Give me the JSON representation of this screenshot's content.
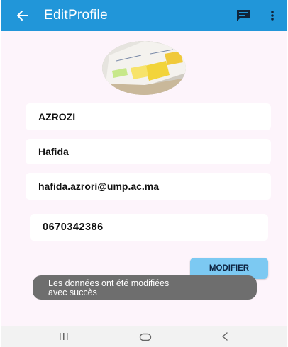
{
  "appbar": {
    "title": "EditProfile",
    "back_icon": "arrow-left-icon",
    "message_icon": "message-icon",
    "more_icon": "more-vertical-icon",
    "color": "#2196d9"
  },
  "profile": {
    "last_name": "AZROZI",
    "first_name": "Hafida",
    "email": "hafida.azrori@ump.ac.ma",
    "phone": "0670342386"
  },
  "actions": {
    "modify_label": "MODIFIER"
  },
  "toast": {
    "line1": "Les données ont été modifiées",
    "line2": "avec succès"
  },
  "navbar": {
    "recent_icon": "recent-apps-icon",
    "home_icon": "home-icon",
    "back_icon": "back-icon"
  }
}
